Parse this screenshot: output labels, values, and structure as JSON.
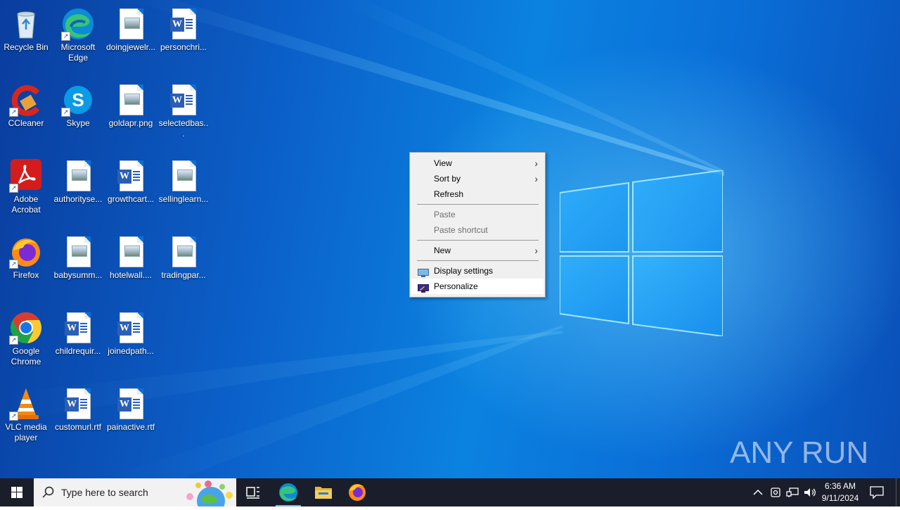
{
  "desktop": {
    "icons": [
      {
        "label": "Recycle Bin",
        "icon": "recycle-bin-icon"
      },
      {
        "label": "Microsoft Edge",
        "icon": "edge-icon"
      },
      {
        "label": "doingjewelr...",
        "icon": "image-file-icon"
      },
      {
        "label": "personchri...",
        "icon": "word-doc-icon"
      },
      {
        "label": "CCleaner",
        "icon": "ccleaner-icon"
      },
      {
        "label": "Skype",
        "icon": "skype-icon"
      },
      {
        "label": "goldapr.png",
        "icon": "image-file-icon"
      },
      {
        "label": "selectedbas...",
        "icon": "word-doc-icon"
      },
      {
        "label": "Adobe Acrobat",
        "icon": "acrobat-icon"
      },
      {
        "label": "authorityse...",
        "icon": "image-file-icon"
      },
      {
        "label": "growthcart...",
        "icon": "word-doc-icon"
      },
      {
        "label": "sellinglearn...",
        "icon": "image-file-icon"
      },
      {
        "label": "Firefox",
        "icon": "firefox-icon"
      },
      {
        "label": "babysumm...",
        "icon": "image-file-icon"
      },
      {
        "label": "hotelwall....",
        "icon": "image-file-icon"
      },
      {
        "label": "tradingpar...",
        "icon": "image-file-icon"
      },
      {
        "label": "Google Chrome",
        "icon": "chrome-icon"
      },
      {
        "label": "childrequir...",
        "icon": "word-doc-icon"
      },
      {
        "label": "joinedpath...",
        "icon": "word-doc-icon"
      },
      {
        "label": "VLC media player",
        "icon": "vlc-icon"
      },
      {
        "label": "customurl.rtf",
        "icon": "word-doc-icon"
      },
      {
        "label": "painactive.rtf",
        "icon": "word-doc-icon"
      }
    ]
  },
  "context_menu": {
    "view": "View",
    "sort_by": "Sort by",
    "refresh": "Refresh",
    "paste": "Paste",
    "paste_shortcut": "Paste shortcut",
    "new": "New",
    "display_settings": "Display settings",
    "personalize": "Personalize"
  },
  "taskbar": {
    "search_placeholder": "Type here to search",
    "time": "6:36 AM",
    "date": "9/11/2024",
    "pinned": [
      "task-view-icon",
      "edge-icon",
      "file-explorer-icon",
      "firefox-icon"
    ]
  },
  "watermark": {
    "text": "ANY RUN"
  },
  "colors": {
    "desktop_blue": "#0b6fd8",
    "taskbar": "#1a1e2b",
    "menu_bg": "#f0f0f0"
  }
}
